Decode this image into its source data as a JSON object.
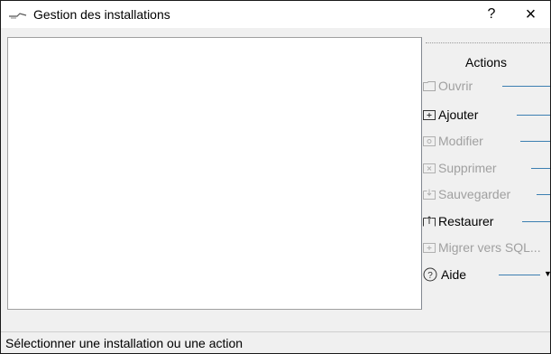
{
  "window": {
    "title": "Gestion des installations",
    "help_label": "?",
    "close_label": "×"
  },
  "panel": {
    "title": "Actions",
    "actions": [
      {
        "label": "Ouvrir",
        "icon": "folder-open-icon",
        "enabled": false
      },
      {
        "label": "Ajouter",
        "icon": "folder-add-icon",
        "enabled": true
      },
      {
        "label": "Modifier",
        "icon": "folder-edit-icon",
        "enabled": false
      },
      {
        "label": "Supprimer",
        "icon": "folder-delete-icon",
        "enabled": false
      },
      {
        "label": "Sauvegarder",
        "icon": "backup-icon",
        "enabled": false
      },
      {
        "label": "Restaurer",
        "icon": "restore-icon",
        "enabled": true
      },
      {
        "label": "Migrer vers SQL...",
        "icon": "migrate-sql-icon",
        "enabled": false
      },
      {
        "label": "Aide",
        "icon": "help-circle-icon",
        "enabled": true
      }
    ]
  },
  "status_bar": {
    "text": "Sélectionner une installation ou une action"
  }
}
